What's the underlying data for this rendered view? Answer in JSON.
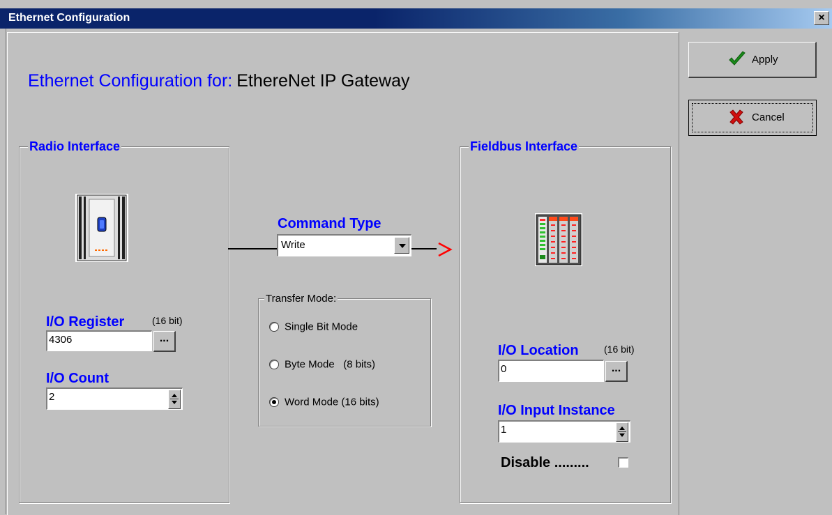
{
  "window": {
    "title": "Ethernet Configuration",
    "close_glyph": "×"
  },
  "header": {
    "prefix": "Ethernet Configuration for:",
    "device": "EthereNet IP Gateway"
  },
  "radio_interface": {
    "legend": "Radio Interface",
    "icon": "radio-device-icon",
    "io_register": {
      "label": "I/O Register",
      "note": "(16 bit)",
      "value": "4306",
      "browse": "..."
    },
    "io_count": {
      "label": "I/O Count",
      "value": "2"
    }
  },
  "command": {
    "label": "Command Type",
    "selected": "Write",
    "arrow_glyph": ">"
  },
  "transfer_mode": {
    "legend": "Transfer Mode:",
    "options": [
      {
        "label": "Single Bit Mode",
        "selected": false
      },
      {
        "label": "Byte Mode   (8 bits)",
        "selected": false
      },
      {
        "label": "Word Mode (16 bits)",
        "selected": true
      }
    ]
  },
  "fieldbus_interface": {
    "legend": "Fieldbus Interface",
    "icon": "fieldbus-module-icon",
    "io_location": {
      "label": "I/O Location",
      "note": "(16 bit)",
      "value": "0",
      "browse": "..."
    },
    "io_input_instance": {
      "label": "I/O Input Instance",
      "value": "1"
    },
    "disable": {
      "label": "Disable .........",
      "checked": false
    }
  },
  "buttons": {
    "apply": "Apply",
    "cancel": "Cancel"
  },
  "colors": {
    "label_blue": "#0000ff",
    "arrow_red": "#ff0000",
    "face": "#c0c0c0",
    "titlebar": "#0a246a"
  }
}
